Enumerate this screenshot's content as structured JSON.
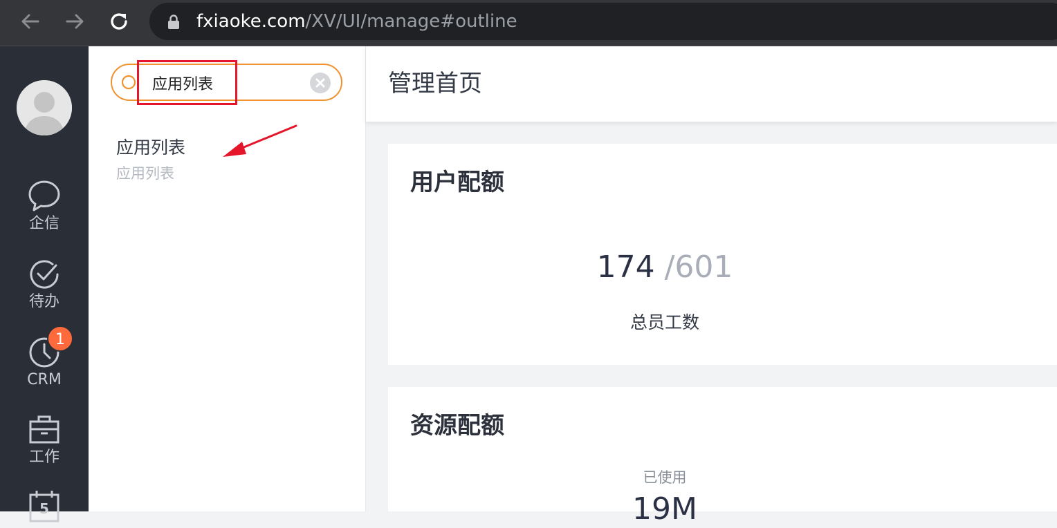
{
  "browser": {
    "url_host": "fxiaoke.com",
    "url_path": "/XV/UI/manage#outline"
  },
  "sidebar": {
    "items": [
      {
        "label": "企信",
        "icon": "chat-bubble-icon"
      },
      {
        "label": "待办",
        "icon": "check-circle-icon"
      },
      {
        "label": "CRM",
        "icon": "clock-icon",
        "badge": "1"
      },
      {
        "label": "工作",
        "icon": "briefcase-icon"
      },
      {
        "label": "",
        "icon": "calendar-icon",
        "calendar_day": "5"
      }
    ]
  },
  "search": {
    "value": "应用列表",
    "results": [
      {
        "title": "应用列表",
        "subtitle": "应用列表"
      }
    ]
  },
  "main": {
    "page_title": "管理首页",
    "user_quota": {
      "title": "用户配额",
      "used": "174",
      "total": "/601",
      "label": "总员工数"
    },
    "resource_quota": {
      "title": "资源配额",
      "used_label": "已使用",
      "used_value": "19M"
    }
  },
  "colors": {
    "accent_orange": "#f0922f",
    "badge": "#ff6a3c",
    "highlight_red": "#e5162b",
    "rail_bg": "#2a2e37"
  }
}
